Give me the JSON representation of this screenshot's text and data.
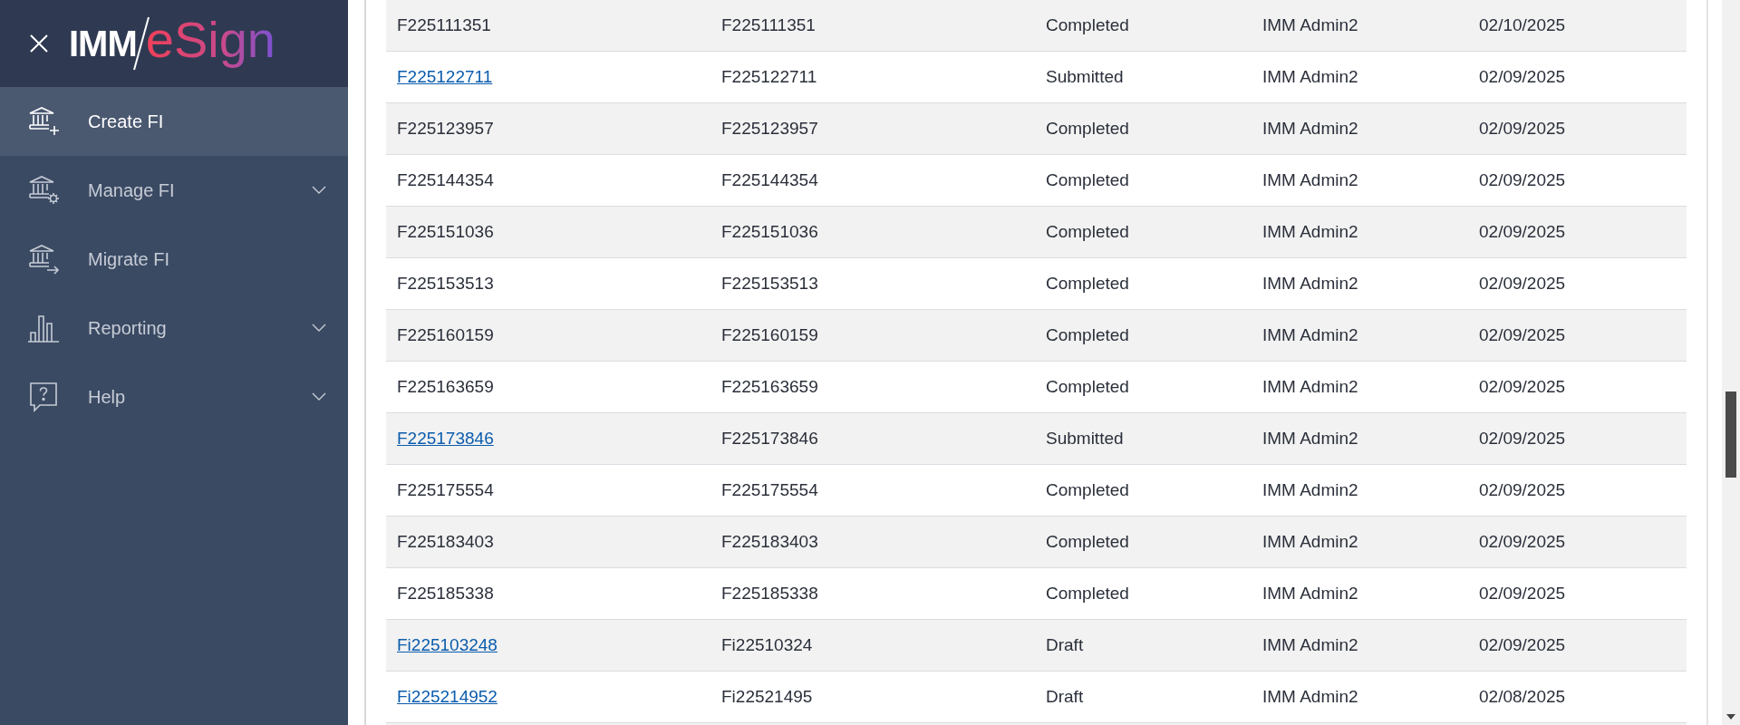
{
  "sidebar": {
    "logo": {
      "left": "IMM",
      "right": "eSign"
    },
    "items": [
      {
        "label": "Create FI",
        "selected": true,
        "kind": "link"
      },
      {
        "label": "Manage FI",
        "selected": false,
        "kind": "menu"
      },
      {
        "label": "Migrate FI",
        "selected": false,
        "kind": "link"
      },
      {
        "label": "Reporting",
        "selected": false,
        "kind": "menu"
      },
      {
        "label": "Help",
        "selected": false,
        "kind": "menu"
      }
    ]
  },
  "table": {
    "rows": [
      {
        "cells": [
          "F225111351",
          "F225111351",
          "Completed",
          "IMM Admin2",
          "02/10/2025"
        ],
        "link": false
      },
      {
        "cells": [
          "F225122711",
          "F225122711",
          "Submitted",
          "IMM Admin2",
          "02/09/2025"
        ],
        "link": true
      },
      {
        "cells": [
          "F225123957",
          "F225123957",
          "Completed",
          "IMM Admin2",
          "02/09/2025"
        ],
        "link": false
      },
      {
        "cells": [
          "F225144354",
          "F225144354",
          "Completed",
          "IMM Admin2",
          "02/09/2025"
        ],
        "link": false
      },
      {
        "cells": [
          "F225151036",
          "F225151036",
          "Completed",
          "IMM Admin2",
          "02/09/2025"
        ],
        "link": false
      },
      {
        "cells": [
          "F225153513",
          "F225153513",
          "Completed",
          "IMM Admin2",
          "02/09/2025"
        ],
        "link": false
      },
      {
        "cells": [
          "F225160159",
          "F225160159",
          "Completed",
          "IMM Admin2",
          "02/09/2025"
        ],
        "link": false
      },
      {
        "cells": [
          "F225163659",
          "F225163659",
          "Completed",
          "IMM Admin2",
          "02/09/2025"
        ],
        "link": false
      },
      {
        "cells": [
          "F225173846",
          "F225173846",
          "Submitted",
          "IMM Admin2",
          "02/09/2025"
        ],
        "link": true
      },
      {
        "cells": [
          "F225175554",
          "F225175554",
          "Completed",
          "IMM Admin2",
          "02/09/2025"
        ],
        "link": false
      },
      {
        "cells": [
          "F225183403",
          "F225183403",
          "Completed",
          "IMM Admin2",
          "02/09/2025"
        ],
        "link": false
      },
      {
        "cells": [
          "F225185338",
          "F225185338",
          "Completed",
          "IMM Admin2",
          "02/09/2025"
        ],
        "link": false
      },
      {
        "cells": [
          "Fi225103248",
          "Fi22510324",
          "Draft",
          "IMM Admin2",
          "02/09/2025"
        ],
        "link": true
      },
      {
        "cells": [
          "Fi225214952",
          "Fi22521495",
          "Draft",
          "IMM Admin2",
          "02/08/2025"
        ],
        "link": true
      }
    ]
  }
}
